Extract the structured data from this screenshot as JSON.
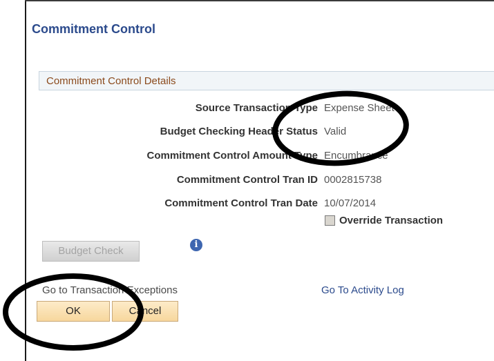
{
  "page": {
    "title": "Commitment Control"
  },
  "section": {
    "label": "Commitment Control Details"
  },
  "fields": [
    {
      "label": "Source Transaction Type",
      "value": "Expense Sheet"
    },
    {
      "label": "Budget Checking Header Status",
      "value": "Valid"
    },
    {
      "label": "Commitment Control Amount Type",
      "value": "Encumbrance"
    },
    {
      "label": "Commitment Control Tran ID",
      "value": "0002815738"
    },
    {
      "label": "Commitment Control Tran Date",
      "value": "10/07/2014"
    }
  ],
  "override": {
    "label": "Override Transaction",
    "checked": false
  },
  "buttons": {
    "budget_check": "Budget Check",
    "ok": "OK",
    "cancel": "Cancel"
  },
  "links": {
    "exceptions": "Go to Transaction Exceptions",
    "activity_log": "Go To Activity Log"
  },
  "icons": {
    "info": "info-icon",
    "info_glyph": "i"
  }
}
